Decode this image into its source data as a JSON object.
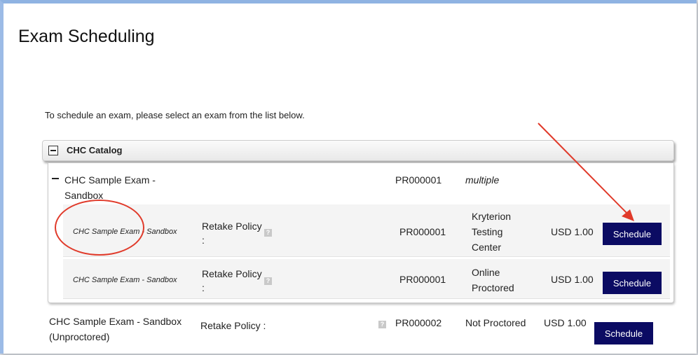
{
  "page": {
    "title": "Exam Scheduling",
    "intro": "To schedule an exam, please select an exam from the list below."
  },
  "catalog": {
    "name": "CHC Catalog",
    "group": {
      "name_line1": "CHC Sample Exam -",
      "name_line2": "Sandbox",
      "code": "PR000001",
      "delivery": "multiple",
      "rows": [
        {
          "name": "CHC Sample Exam - Sandbox",
          "policy_label": "Retake Policy",
          "policy_colon": ":",
          "code": "PR000001",
          "delivery_lines": [
            "Kryterion",
            "Testing",
            "Center"
          ],
          "price": "USD 1.00",
          "button": "Schedule"
        },
        {
          "name": "CHC Sample Exam - Sandbox",
          "policy_label": "Retake Policy",
          "policy_colon": ":",
          "code": "PR000001",
          "delivery_lines": [
            "Online",
            "Proctored"
          ],
          "price": "USD 1.00",
          "button": "Schedule"
        }
      ]
    }
  },
  "standalone": {
    "name_line1": "CHC Sample Exam - Sandbox",
    "name_line2": "(Unproctored)",
    "policy_label": "Retake Policy :",
    "code": "PR000002",
    "delivery": "Not Proctored",
    "price": "USD 1.00",
    "button": "Schedule"
  },
  "icons": {
    "help": "help-icon",
    "collapse": "minus-icon"
  },
  "colors": {
    "button": "#0b0b63",
    "annotation": "#e03a2a",
    "frame": "#8fb3e2"
  }
}
